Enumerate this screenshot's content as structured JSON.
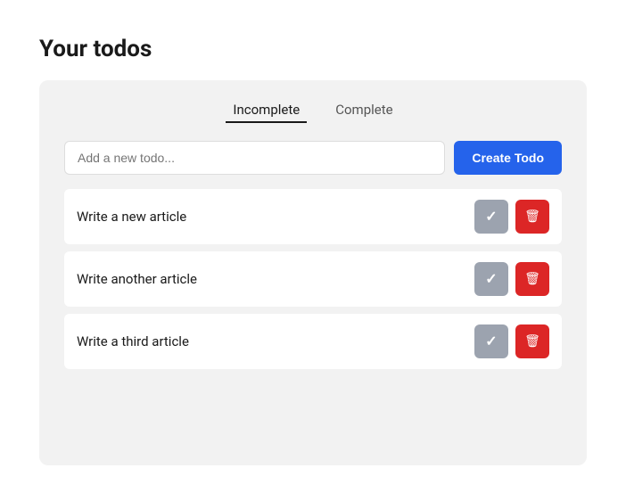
{
  "page": {
    "title": "Your todos"
  },
  "tabs": [
    {
      "label": "Incomplete",
      "active": true
    },
    {
      "label": "Complete",
      "active": false
    }
  ],
  "input": {
    "placeholder": "Add a new todo...",
    "value": ""
  },
  "create_button": {
    "label": "Create Todo"
  },
  "todos": [
    {
      "id": 1,
      "text": "Write a new article"
    },
    {
      "id": 2,
      "text": "Write another article"
    },
    {
      "id": 3,
      "text": "Write a third article"
    }
  ],
  "colors": {
    "create_btn": "#2563eb",
    "check_btn": "#9ca3af",
    "delete_btn": "#dc2626"
  }
}
